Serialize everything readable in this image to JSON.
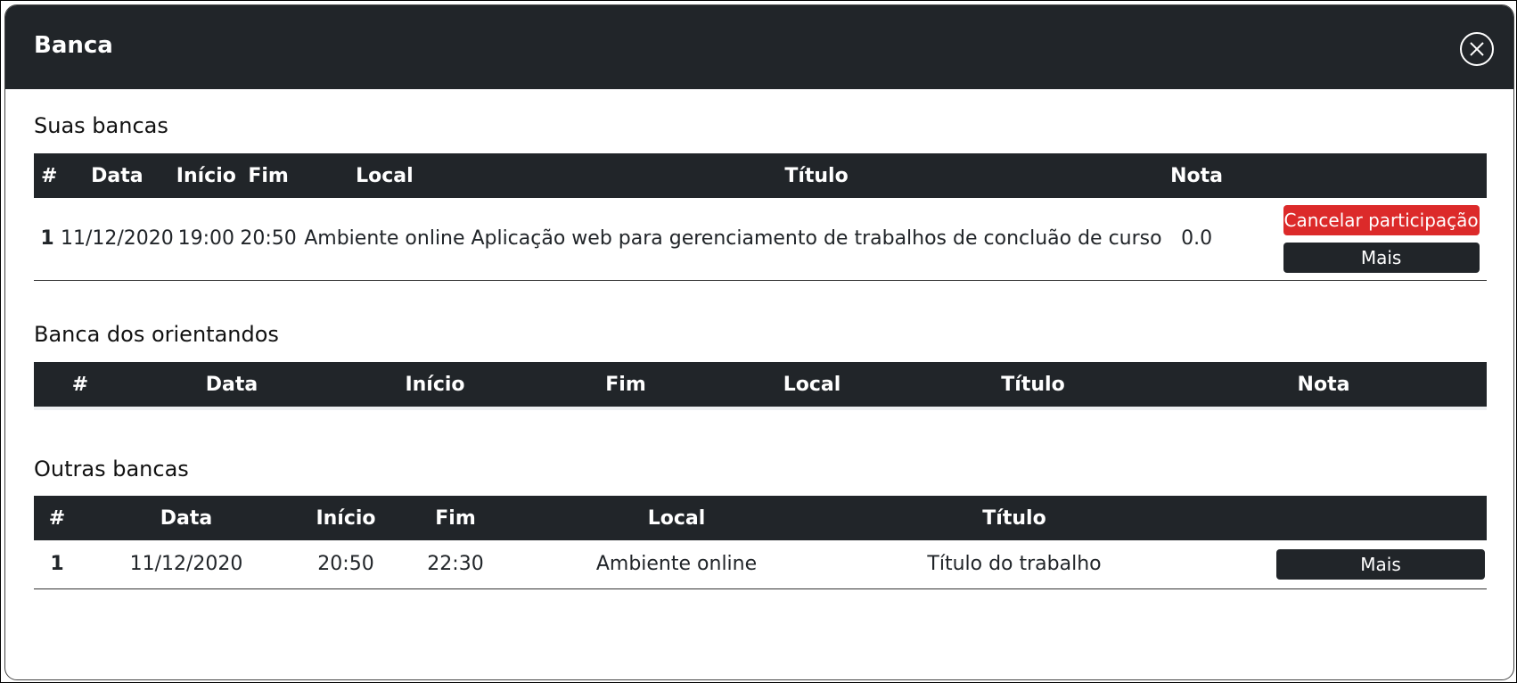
{
  "modal": {
    "title": "Banca"
  },
  "suas_bancas": {
    "title": "Suas bancas",
    "columns": [
      "#",
      "Data",
      "Início",
      "Fim",
      "Local",
      "Título",
      "Nota",
      ""
    ],
    "rows": [
      {
        "num": "1",
        "data": "11/12/2020",
        "inicio": "19:00",
        "fim": "20:50",
        "local": "Ambiente online",
        "titulo": "Aplicação web para gerenciamento de trabalhos de concluão de curso",
        "nota": "0.0",
        "cancel_label": "Cancelar participação",
        "more_label": "Mais"
      }
    ]
  },
  "banca_orientandos": {
    "title": "Banca dos orientandos",
    "columns": [
      "#",
      "Data",
      "Início",
      "Fim",
      "Local",
      "Título",
      "Nota"
    ]
  },
  "outras_bancas": {
    "title": "Outras bancas",
    "columns": [
      "#",
      "Data",
      "Início",
      "Fim",
      "Local",
      "Título",
      ""
    ],
    "rows": [
      {
        "num": "1",
        "data": "11/12/2020",
        "inicio": "20:50",
        "fim": "22:30",
        "local": "Ambiente online",
        "titulo": "Título do trabalho",
        "more_label": "Mais"
      }
    ]
  },
  "colors": {
    "header_bg": "#212529",
    "danger": "#dc2a2a"
  }
}
